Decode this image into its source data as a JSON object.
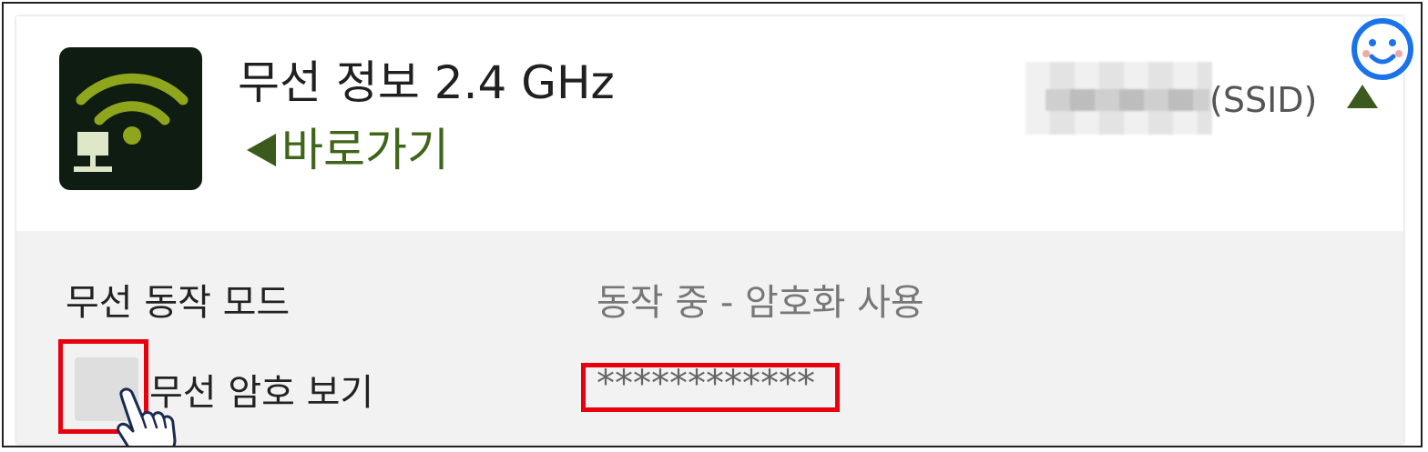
{
  "header": {
    "title": "무선 정보 2.4 GHz",
    "shortcut_label": "바로가기",
    "ssid_suffix": "(SSID)"
  },
  "wireless_mode": {
    "label": "무선 동작 모드",
    "value": "동작 중 - 암호화 사용"
  },
  "password": {
    "label": "무선 암호 보기",
    "value": "************",
    "checked": false
  },
  "icons": {
    "app": "wifi-router-icon",
    "shortcut": "triangle-left-icon",
    "collapse": "triangle-up-icon",
    "cursor": "pointing-hand-icon",
    "badge": "smiley-icon"
  },
  "colors": {
    "accent_green": "#3f6519",
    "icon_bg": "#0e1c12",
    "highlight_red": "#e8000d",
    "smiley_blue": "#1a73e8"
  }
}
